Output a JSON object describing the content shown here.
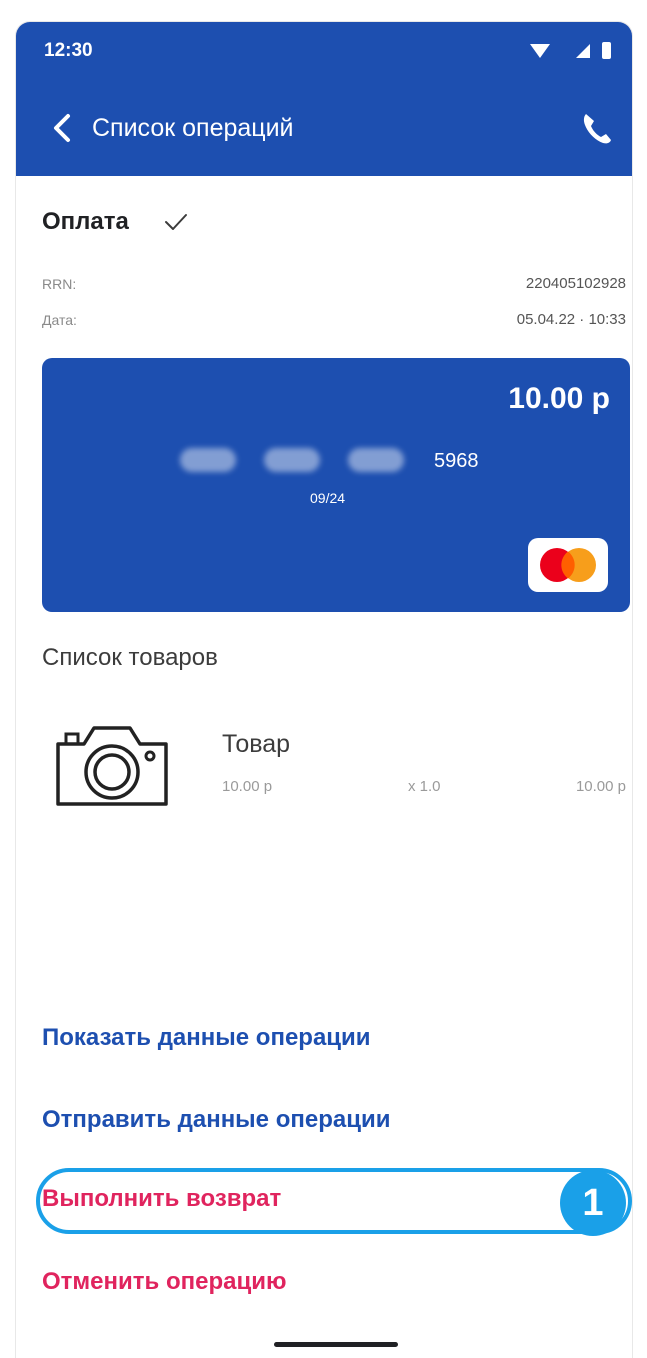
{
  "status_bar": {
    "time": "12:30"
  },
  "app_bar": {
    "title": "Список операций"
  },
  "operation": {
    "type": "Оплата",
    "rrn_label": "RRN:",
    "rrn_value": "220405102928",
    "date_label": "Дата:",
    "date_value": "05.04.22 · 10:33"
  },
  "card": {
    "amount": "10.00 р",
    "masked": [
      "0000",
      "0000",
      "0000"
    ],
    "last4": "5968",
    "expiry": "09/24",
    "brand_icon": "mastercard-icon",
    "color": "#1d4fb0"
  },
  "products": {
    "title": "Список товаров",
    "items": [
      {
        "icon": "camera-icon",
        "name": "Товар",
        "price": "10.00 р",
        "qty": "x 1.0",
        "total": "10.00 р"
      }
    ]
  },
  "actions": {
    "show_data": "Показать данные операции",
    "send_data": "Отправить данные операции",
    "refund": "Выполнить возврат",
    "cancel": "Отменить операцию"
  },
  "annotation": {
    "badge": "1",
    "color": "#1aa0e8"
  },
  "colors": {
    "accent": "#1d4fb0",
    "danger": "#e0245e"
  }
}
